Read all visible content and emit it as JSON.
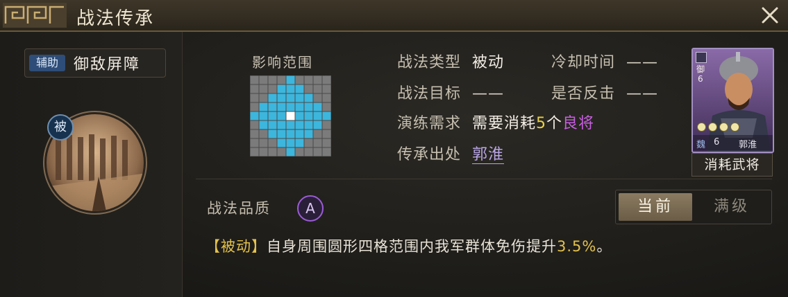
{
  "window": {
    "title": "战法传承",
    "close_icon": "close-icon"
  },
  "skill": {
    "category_badge": "辅助",
    "name": "御敌屏障",
    "passive_badge": "被"
  },
  "range": {
    "title": "影响范围",
    "grid_size": 9,
    "grid_pattern": [
      "000010000",
      "000111000",
      "001111100",
      "011111110",
      "1111C1111",
      "011111110",
      "001111100",
      "000111000",
      "000010000"
    ],
    "colors": {
      "empty": "#7b7b7b",
      "affected": "#3cb6dd",
      "center": "#ffffff",
      "line": "#4a4a4a"
    }
  },
  "info": {
    "type_label": "战法类型",
    "type_value": "被动",
    "cooldown_label": "冷却时间",
    "cooldown_value": "——",
    "target_label": "战法目标",
    "target_value": "——",
    "counter_label": "是否反击",
    "counter_value": "——",
    "require_label": "演练需求",
    "require_prefix": "需要消耗",
    "require_count": "5",
    "require_unit": "个",
    "require_quality": "良将",
    "source_label": "传承出处",
    "source_value": "郭淮"
  },
  "general_card": {
    "faction_mark": "御",
    "level_mark": "6",
    "stars": 4,
    "faction": "魏",
    "cost": "6",
    "name": "郭淮",
    "footer": "消耗武将"
  },
  "quality": {
    "label": "战法品质",
    "grade": "A"
  },
  "toggle": {
    "current_label": "当前",
    "max_label": "满级"
  },
  "description": {
    "tag": "【被动】",
    "text_before": "自身周围圆形四格范围内我军群体免伤提升",
    "value": "3.5%",
    "text_after": "。"
  }
}
